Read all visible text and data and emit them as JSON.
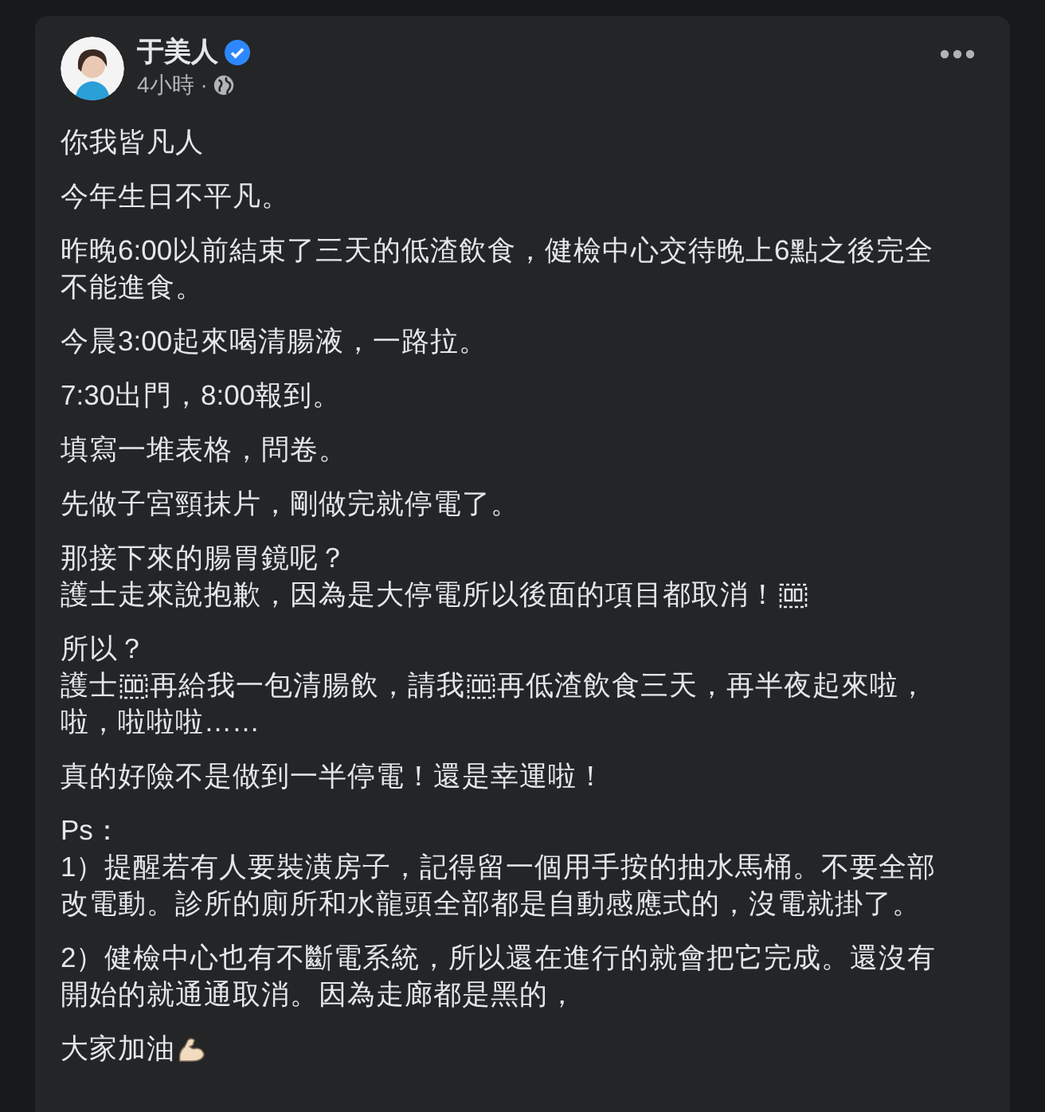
{
  "post": {
    "author": "于美人",
    "verified": true,
    "time": "4小時",
    "separator": "·",
    "paragraphs": [
      {
        "lines": [
          [
            {
              "kind": "text",
              "text": "你我皆凡人"
            }
          ]
        ]
      },
      {
        "lines": [
          [
            {
              "kind": "text",
              "text": "今年生日不平凡。"
            }
          ]
        ]
      },
      {
        "lines": [
          [
            {
              "kind": "text",
              "text": "昨晚6:00以前結束了三天的低渣飲食，健檢中心交待晚上6點之後完全"
            }
          ],
          [
            {
              "kind": "text",
              "text": "不能進食。"
            }
          ]
        ]
      },
      {
        "lines": [
          [
            {
              "kind": "text",
              "text": "今晨3:00起來喝清腸液，一路拉。"
            }
          ]
        ]
      },
      {
        "lines": [
          [
            {
              "kind": "text",
              "text": "7:30出門，8:00報到。"
            }
          ]
        ]
      },
      {
        "lines": [
          [
            {
              "kind": "text",
              "text": "填寫一堆表格，問卷。"
            }
          ]
        ]
      },
      {
        "lines": [
          [
            {
              "kind": "text",
              "text": "先做子宮頸抹片，剛做完就停電了。"
            }
          ]
        ]
      },
      {
        "lines": [
          [
            {
              "kind": "text",
              "text": "那接下來的腸胃鏡呢？"
            }
          ],
          [
            {
              "kind": "text",
              "text": "護士走來說抱歉，因為是大停電所以後面的項目都取消！"
            },
            {
              "kind": "glyph"
            }
          ]
        ]
      },
      {
        "lines": [
          [
            {
              "kind": "text",
              "text": "所以？"
            }
          ],
          [
            {
              "kind": "text",
              "text": "護士"
            },
            {
              "kind": "glyph"
            },
            {
              "kind": "text",
              "text": "再給我一包清腸飲，請我"
            },
            {
              "kind": "glyph"
            },
            {
              "kind": "text",
              "text": "再低渣飲食三天，再半夜起來啦，"
            }
          ],
          [
            {
              "kind": "text",
              "text": "啦，啦啦啦……"
            }
          ]
        ]
      },
      {
        "lines": [
          [
            {
              "kind": "text",
              "text": "真的好險不是做到一半停電！還是幸運啦！"
            }
          ]
        ]
      },
      {
        "lines": [
          [
            {
              "kind": "text",
              "text": "Ps："
            }
          ],
          [
            {
              "kind": "text",
              "text": "1）提醒若有人要裝潢房子，記得留一個用手按的抽水馬桶。不要全部"
            }
          ],
          [
            {
              "kind": "text",
              "text": "改電動。診所的廁所和水龍頭全部都是自動感應式的，沒電就掛了。"
            }
          ]
        ]
      },
      {
        "lines": [
          [
            {
              "kind": "text",
              "text": "2）健檢中心也有不斷電系統，所以還在進行的就會把它完成。還沒有"
            }
          ],
          [
            {
              "kind": "text",
              "text": "開始的就通通取消。因為走廊都是黑的，"
            }
          ]
        ]
      },
      {
        "lines": [
          [
            {
              "kind": "text",
              "text": "大家加油"
            },
            {
              "kind": "emoji"
            }
          ]
        ]
      }
    ]
  }
}
